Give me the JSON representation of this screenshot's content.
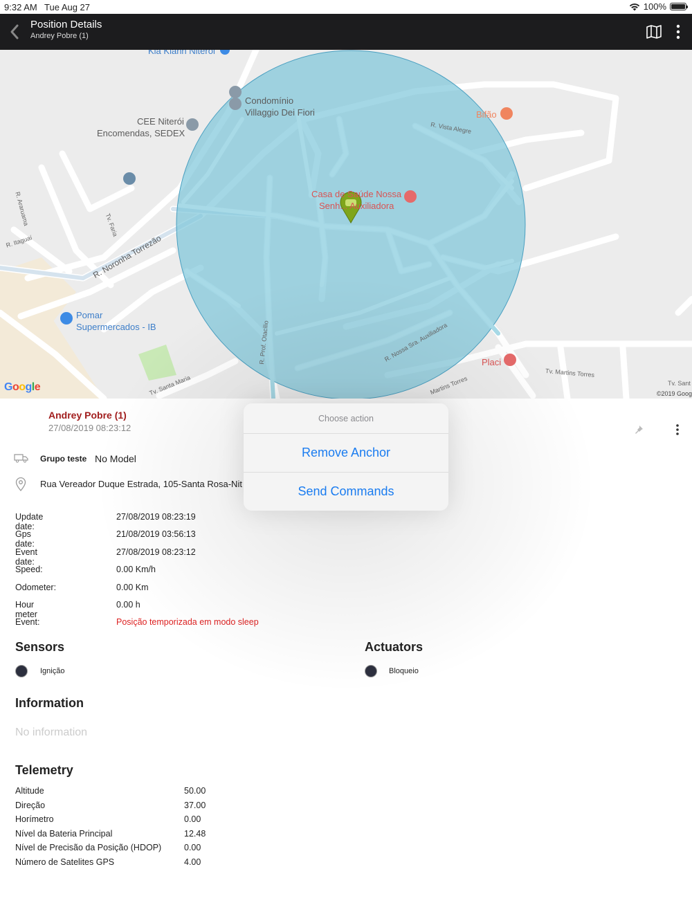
{
  "status_bar": {
    "time": "9:32 AM",
    "date": "Tue Aug 27",
    "battery": "100%"
  },
  "nav": {
    "title": "Position Details",
    "subtitle": "Andrey Pobre (1)"
  },
  "map": {
    "labels": {
      "kia": "Kia Klann Niterói",
      "condominio_1": "Condomínio",
      "condominio_2": "Villaggio Dei Fiori",
      "cee_1": "CEE Niterói",
      "cee_2": "Encomendas, SEDEX",
      "bifao": "Bifão",
      "vista_alegre": "R. Vista Alegre",
      "casa_1": "Casa de Saúde Nossa",
      "casa_2": "Senh... Auxiliadora",
      "aratuama": "R. Araruama",
      "tv_faria": "Tv. Faria",
      "itaguai": "R. Itaguaí",
      "noronha": "R. Noronha Torrezão",
      "pomar_1": "Pomar",
      "pomar_2": "Supermercados - IB",
      "otacilio": "R. Prof. Otacílio",
      "nossa_sra": "R. Nossa Sra. Auxiliadora",
      "placi": "Placi",
      "martins_torres": "Tv. Martins Torres",
      "martins_torres_2": "Martins Torres",
      "santa_maria": "Tv. Santa Maria",
      "tv_sant": "Tv. Sant",
      "copyright": "©2019 Goog",
      "google": "Google"
    }
  },
  "device": {
    "name": "Andrey Pobre (1)",
    "timestamp": "27/08/2019 08:23:12",
    "group": "Grupo teste",
    "model": "No Model",
    "address": "Rua Vereador Duque Estrada, 105-Santa Rosa-Nit"
  },
  "details": [
    {
      "key": "Update date:",
      "value": "27/08/2019 08:23:19"
    },
    {
      "key": "Gps date:",
      "value": "21/08/2019 03:56:13"
    },
    {
      "key": "Event date:",
      "value": "27/08/2019 08:23:12"
    },
    {
      "key": "Speed:",
      "value": "0.00 Km/h"
    },
    {
      "key": "Odometer:",
      "value": "0.00 Km"
    },
    {
      "key": "Hour meter",
      "value": "0.00 h"
    },
    {
      "key": "Event:",
      "value": "Posição temporizada em modo sleep"
    }
  ],
  "sections": {
    "sensors": "Sensors",
    "actuators": "Actuators",
    "information": "Information",
    "telemetry": "Telemetry"
  },
  "sensors": [
    {
      "label": "Ignição"
    }
  ],
  "actuators": [
    {
      "label": "Bloqueio"
    }
  ],
  "information_empty": "No information",
  "telemetry": [
    {
      "key": "Altitude",
      "value": "50.00"
    },
    {
      "key": "Direção",
      "value": "37.00"
    },
    {
      "key": "Horímetro",
      "value": "0.00"
    },
    {
      "key": "Nível da Bateria Principal",
      "value": "12.48"
    },
    {
      "key": "Nível de Precisão da Posição (HDOP)",
      "value": "0.00"
    },
    {
      "key": "Número de Satelites GPS",
      "value": "4.00"
    }
  ],
  "action_sheet": {
    "title": "Choose action",
    "items": [
      "Remove Anchor",
      "Send Commands"
    ]
  },
  "colors": {
    "nav_bg": "#1c1c1e",
    "device_name": "#a11d1d",
    "event_red": "#dd2222",
    "action_blue": "#1a7cf0",
    "geofence": "#7ec6da"
  }
}
